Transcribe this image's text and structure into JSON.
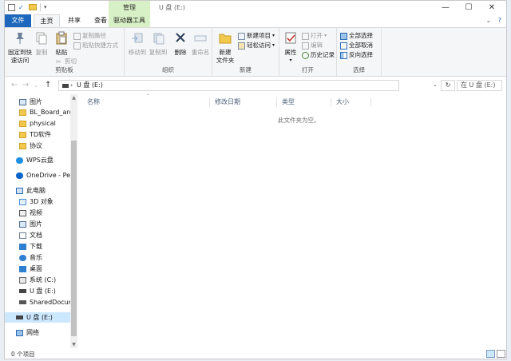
{
  "window": {
    "title": "U 盘 (E:)",
    "context_tab": "管理",
    "minimize": "—",
    "maximize": "☐",
    "close": "✕"
  },
  "tabs": {
    "file": "文件",
    "home": "主页",
    "share": "共享",
    "view": "查看",
    "drive_tools": "驱动器工具"
  },
  "ribbon": {
    "clipboard": {
      "label": "剪贴板",
      "pin": "固定到快\n速访问",
      "copy": "复制",
      "paste": "粘贴",
      "copy_path": "复制路径",
      "paste_shortcut": "粘贴快捷方式",
      "cut": "剪切"
    },
    "organize": {
      "label": "组织",
      "move_to": "移动到",
      "copy_to": "复制到",
      "delete": "删除",
      "rename": "重命名"
    },
    "new": {
      "label": "新建",
      "new_folder": "新建\n文件夹",
      "new_item": "新建项目",
      "easy_access": "轻松访问"
    },
    "open": {
      "label": "打开",
      "properties": "属性",
      "open": "打开",
      "edit": "编辑",
      "history": "历史记录"
    },
    "select": {
      "label": "选择",
      "select_all": "全部选择",
      "select_none": "全部取消",
      "invert": "反向选择"
    }
  },
  "address": {
    "path": "U 盘 (E:)",
    "search_placeholder": "在 U 盘 (E:)",
    "back": "←",
    "forward": "→",
    "up": "↑",
    "dropdown": "⌄",
    "refresh": "↻"
  },
  "nav_pane": {
    "items": [
      {
        "label": "图片",
        "kind": "pictures"
      },
      {
        "label": "BL_Board_arch",
        "kind": "folder"
      },
      {
        "label": "physical",
        "kind": "folder"
      },
      {
        "label": "TD软件",
        "kind": "folder"
      },
      {
        "label": "协议",
        "kind": "folder"
      },
      {
        "label": "WPS云盘",
        "kind": "cloud"
      },
      {
        "label": "OneDrive - Perso",
        "kind": "onedrive"
      },
      {
        "label": "此电脑",
        "kind": "pc"
      },
      {
        "label": "3D 对象",
        "kind": "3d"
      },
      {
        "label": "视频",
        "kind": "video"
      },
      {
        "label": "图片",
        "kind": "pictures"
      },
      {
        "label": "文档",
        "kind": "docs"
      },
      {
        "label": "下载",
        "kind": "download"
      },
      {
        "label": "音乐",
        "kind": "music"
      },
      {
        "label": "桌面",
        "kind": "desktop"
      },
      {
        "label": "系统 (C:)",
        "kind": "drive"
      },
      {
        "label": "U 盘 (E:)",
        "kind": "usb"
      },
      {
        "label": "SharedDocume",
        "kind": "netdrive"
      },
      {
        "label": "U 盘 (E:)",
        "kind": "usb"
      },
      {
        "label": "网络",
        "kind": "network"
      }
    ]
  },
  "columns": {
    "name": "名称",
    "modified": "修改日期",
    "type": "类型",
    "size": "大小"
  },
  "empty_message": "此文件夹为空。",
  "status": {
    "count": "0 个项目"
  },
  "colors": {
    "file_tab": "#1d68bd",
    "context_tab": "#d8f0c6",
    "selected": "#cce8ff",
    "column_text": "#4c607a"
  }
}
